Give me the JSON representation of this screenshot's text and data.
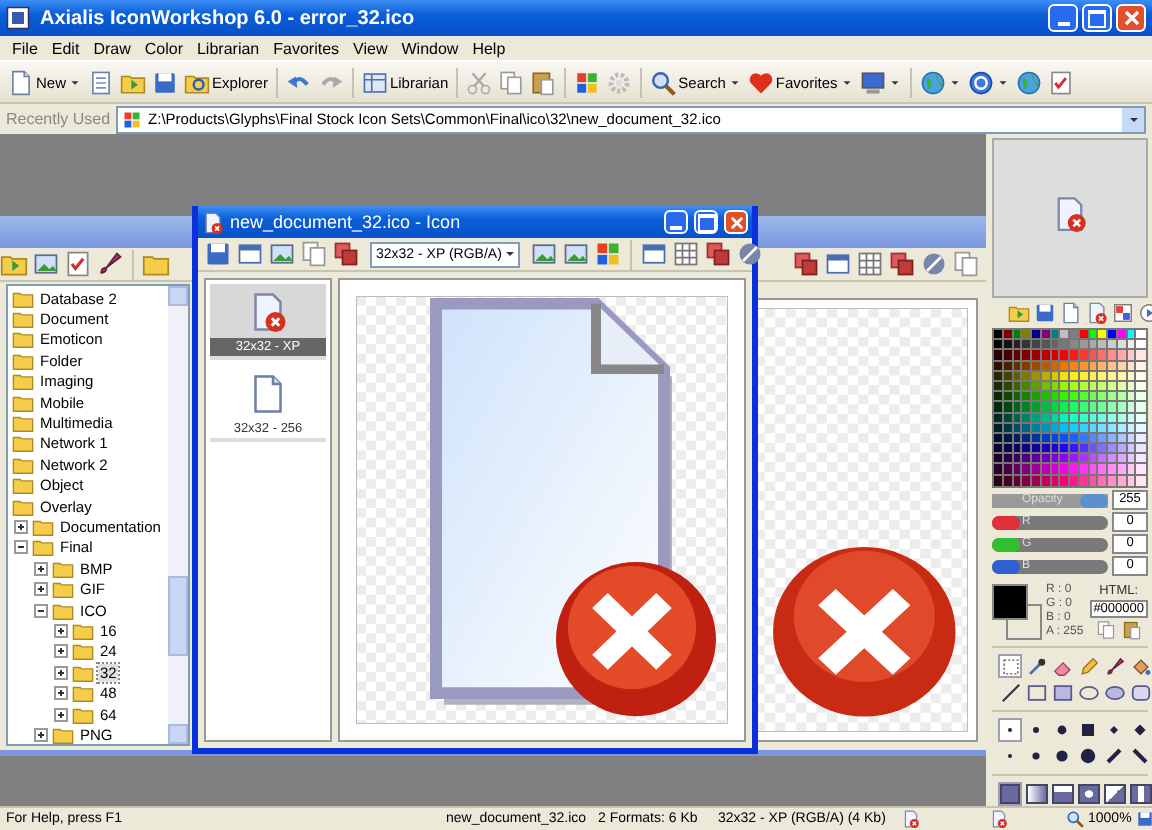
{
  "window": {
    "title": "Axialis IconWorkshop 6.0 - error_32.ico"
  },
  "menu": [
    "File",
    "Edit",
    "Draw",
    "Color",
    "Librarian",
    "Favorites",
    "View",
    "Window",
    "Help"
  ],
  "toolbar": [
    {
      "kind": "new",
      "label": "New",
      "dropdown": true
    },
    {
      "kind": "book",
      "dropdown": false
    },
    {
      "kind": "open",
      "dropdown": false
    },
    {
      "kind": "save",
      "dropdown": false
    },
    {
      "kind": "explorer",
      "label": "Explorer",
      "dropdown": false
    },
    {
      "kind": "separator"
    },
    {
      "kind": "undo",
      "dropdown": false
    },
    {
      "kind": "redo",
      "dropdown": false
    },
    {
      "kind": "separator"
    },
    {
      "kind": "librarian",
      "label": "Librarian",
      "dropdown": false
    },
    {
      "kind": "separator"
    },
    {
      "kind": "cut",
      "dropdown": false
    },
    {
      "kind": "copy",
      "dropdown": false
    },
    {
      "kind": "paste",
      "dropdown": false
    },
    {
      "kind": "separator"
    },
    {
      "kind": "flag",
      "dropdown": false
    },
    {
      "kind": "gear",
      "dropdown": false
    },
    {
      "kind": "separator"
    },
    {
      "kind": "search",
      "label": "Search",
      "dropdown": true
    },
    {
      "kind": "favorites",
      "label": "Favorites",
      "dropdown": true
    },
    {
      "kind": "monitor",
      "dropdown": true
    },
    {
      "kind": "separator"
    },
    {
      "kind": "globe",
      "dropdown": true
    },
    {
      "kind": "help",
      "dropdown": true
    },
    {
      "kind": "globe",
      "dropdown": false
    },
    {
      "kind": "check",
      "dropdown": false
    }
  ],
  "address_bar": {
    "label": "Recently Used",
    "path": "Z:\\Products\\Glyphs\\Final Stock Icon Sets\\Common\\Final\\ico\\32\\new_document_32.ico"
  },
  "library_window": {
    "tree": [
      {
        "label": "Database 2",
        "selected": false
      },
      {
        "label": "Document",
        "selected": false
      },
      {
        "label": "Emoticon",
        "selected": false
      },
      {
        "label": "Folder",
        "selected": false
      },
      {
        "label": "Imaging",
        "selected": false
      },
      {
        "label": "Mobile",
        "selected": false
      },
      {
        "label": "Multimedia",
        "selected": false
      },
      {
        "label": "Network 1",
        "selected": false
      },
      {
        "label": "Network 2",
        "selected": false
      },
      {
        "label": "Object",
        "selected": false
      },
      {
        "label": "Overlay",
        "selected": false,
        "children": [
          {
            "label": "Documentation",
            "selected": false,
            "expanded": false
          },
          {
            "label": "Final",
            "selected": false,
            "expanded": true,
            "children": [
              {
                "label": "BMP",
                "selected": false,
                "expanded": false
              },
              {
                "label": "GIF",
                "selected": false,
                "expanded": false
              },
              {
                "label": "ICO",
                "selected": false,
                "expanded": true,
                "children": [
                  {
                    "label": "16",
                    "selected": false,
                    "expanded": false
                  },
                  {
                    "label": "24",
                    "selected": false,
                    "expanded": false
                  },
                  {
                    "label": "32",
                    "selected": true,
                    "expanded": false
                  },
                  {
                    "label": "48",
                    "selected": false,
                    "expanded": false
                  },
                  {
                    "label": "64",
                    "selected": false,
                    "expanded": false
                  }
                ]
              },
              {
                "label": "PNG",
                "selected": false,
                "expanded": false
              }
            ]
          }
        ]
      }
    ]
  },
  "icon_window": {
    "title": "new_document_32.ico - Icon",
    "format": "32x32 - XP (RGB/A)",
    "formats": [
      {
        "label": "32x32 - XP",
        "kind": "error",
        "selected": true
      },
      {
        "label": "32x32 - 256",
        "kind": "plain",
        "selected": false
      }
    ]
  },
  "panel": {
    "sliders": [
      {
        "label": "Opacity",
        "value": "255",
        "level": 1,
        "color": "#5a8fd0"
      },
      {
        "label": "R",
        "value": "0",
        "level": 0,
        "color": "#e0303a"
      },
      {
        "label": "G",
        "value": "0",
        "level": 0,
        "color": "#2fc02f"
      },
      {
        "label": "B",
        "value": "0",
        "level": 0,
        "color": "#2f5fd0"
      }
    ],
    "channels": [
      {
        "label": "R :",
        "value": "0"
      },
      {
        "label": "G :",
        "value": "0"
      },
      {
        "label": "B :",
        "value": "0"
      },
      {
        "label": "A :",
        "value": "255"
      }
    ],
    "html_label": "HTML:",
    "html_value": "#000000",
    "tools": [
      {
        "selected": true
      },
      {
        "selected": false
      },
      {
        "selected": false
      },
      {
        "selected": false
      },
      {
        "selected": false
      },
      {
        "selected": false
      },
      {
        "selected": false
      },
      {
        "selected": false
      },
      {
        "selected": false
      },
      {
        "selected": false
      },
      {
        "selected": false
      },
      {
        "selected": false
      }
    ],
    "brushes": [
      {
        "selected": true
      },
      {
        "selected": false
      },
      {
        "selected": false
      },
      {
        "selected": false
      },
      {
        "selected": false
      },
      {
        "selected": false
      },
      {
        "selected": false
      },
      {
        "selected": false
      },
      {
        "selected": false
      },
      {
        "selected": false
      },
      {
        "selected": false
      },
      {
        "selected": false
      }
    ],
    "fills": [
      {
        "selected": true
      },
      {
        "selected": false
      },
      {
        "selected": false
      },
      {
        "selected": false
      },
      {
        "selected": false
      },
      {
        "selected": false
      }
    ]
  },
  "status_bar": {
    "help": "For Help, press F1",
    "file": "new_document_32.ico",
    "formats": "2 Formats: 6 Kb",
    "format": "32x32 - XP (RGB/A) (4 Kb)",
    "zoom": "1000%"
  }
}
